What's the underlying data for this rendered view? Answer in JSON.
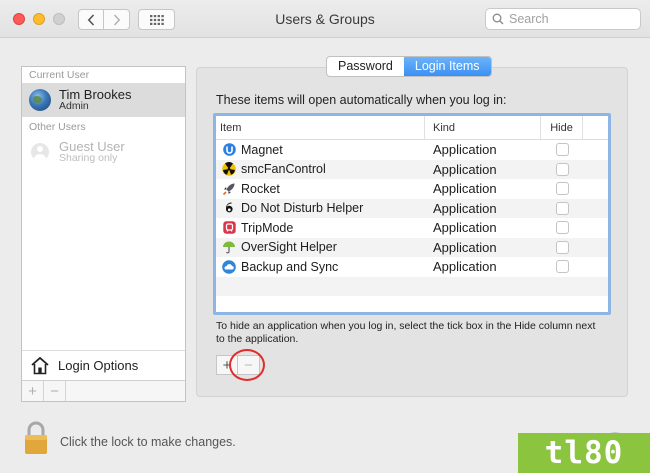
{
  "window": {
    "title": "Users & Groups"
  },
  "toolbar": {
    "back_icon": "chevron-left-icon",
    "forward_icon": "chevron-right-icon",
    "grid_icon": "grid-icon"
  },
  "search": {
    "placeholder": "Search",
    "value": ""
  },
  "sidebar": {
    "current_user_label": "Current User",
    "current_user": {
      "name": "Tim Brookes",
      "role": "Admin"
    },
    "other_users_label": "Other Users",
    "other_users": [
      {
        "name": "Guest User",
        "status": "Sharing only"
      }
    ],
    "login_options_label": "Login Options",
    "add_label": "+",
    "remove_label": "−"
  },
  "tabs": [
    {
      "label": "Password",
      "active": false
    },
    {
      "label": "Login Items",
      "active": true
    }
  ],
  "intro_text": "These items will open automatically when you log in:",
  "table": {
    "columns": [
      "Item",
      "Kind",
      "Hide"
    ],
    "rows": [
      {
        "item": "Magnet",
        "kind": "Application",
        "hide": false,
        "icon": "magnet-icon"
      },
      {
        "item": "smcFanControl",
        "kind": "Application",
        "hide": false,
        "icon": "fan-icon"
      },
      {
        "item": "Rocket",
        "kind": "Application",
        "hide": false,
        "icon": "rocket-icon"
      },
      {
        "item": "Do Not Disturb Helper",
        "kind": "Application",
        "hide": false,
        "icon": "dnd-icon"
      },
      {
        "item": "TripMode",
        "kind": "Application",
        "hide": false,
        "icon": "tripmode-icon"
      },
      {
        "item": "OverSight Helper",
        "kind": "Application",
        "hide": false,
        "icon": "umbrella-icon"
      },
      {
        "item": "Backup and Sync",
        "kind": "Application",
        "hide": false,
        "icon": "cloud-icon"
      }
    ]
  },
  "hint_text": "To hide an application when you log in, select the tick box in the Hide column next to the application.",
  "list_controls": {
    "add_label": "+",
    "remove_label": "−"
  },
  "lock_text": "Click the lock to make changes.",
  "brand_text": "tl80",
  "colors": {
    "accent": "#3b8ff5",
    "selection_border": "#8db5e6",
    "annotation": "#e02c2c",
    "brand": "#8bc53f"
  }
}
